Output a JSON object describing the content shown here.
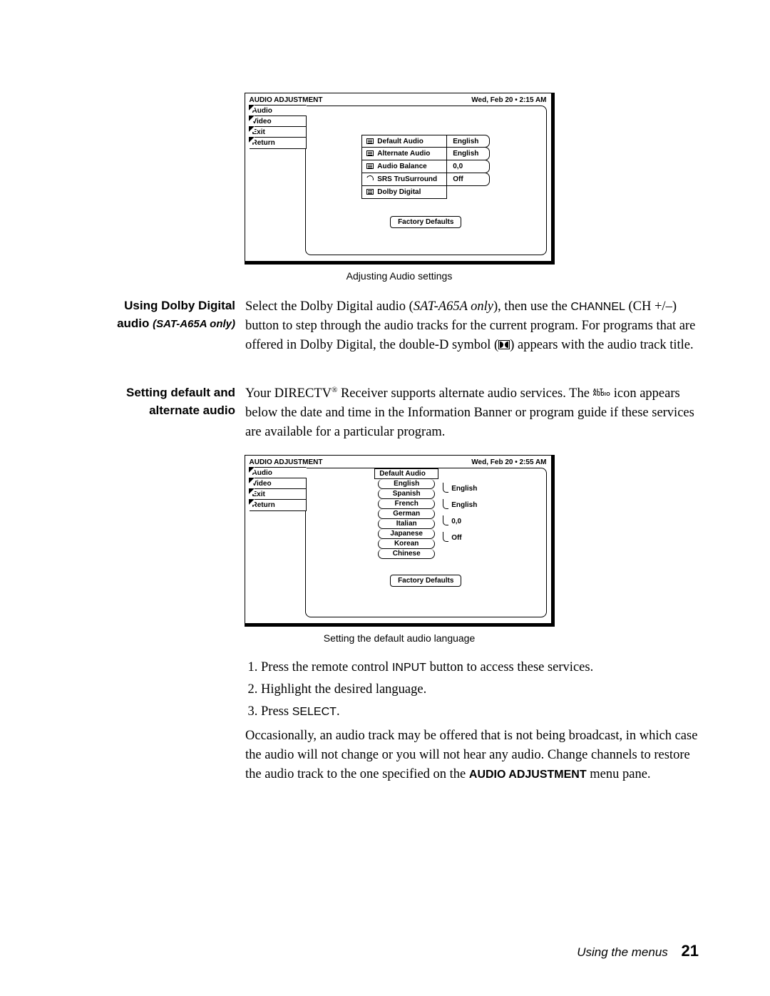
{
  "figure1": {
    "title": "AUDIO ADJUSTMENT",
    "timestamp": "Wed, Feb 20  •  2:15 AM",
    "tabs": [
      "Audio",
      "Video",
      "Exit",
      "Return"
    ],
    "options": [
      {
        "label": "Default Audio",
        "value": "English",
        "icon": "list"
      },
      {
        "label": "Alternate Audio",
        "value": "English",
        "icon": "list"
      },
      {
        "label": "Audio Balance",
        "value": "0,0",
        "icon": "list"
      },
      {
        "label": "SRS TruSurround",
        "value": "Off",
        "icon": "cycle"
      },
      {
        "label": "Dolby Digital",
        "value": "",
        "icon": "list"
      }
    ],
    "factory": "Factory Defaults",
    "caption": "Adjusting Audio settings"
  },
  "section1": {
    "heading_a": "Using Dolby Digital",
    "heading_b": "audio",
    "heading_note": "(SAT-A65A only)",
    "para_a": "Select the Dolby Digital audio (",
    "para_a_em": "SAT-A65A only",
    "para_a2": "), then use the ",
    "para_a_sc": "CHANNEL",
    "para_b": "(CH +/–) button to step through the audio tracks for the current program. For programs that are offered in Dolby Digital, the double-D symbol (",
    "para_b2": ") appears with the audio track title."
  },
  "section2": {
    "heading_a": "Setting default and",
    "heading_b": "alternate audio",
    "para_a": "Your DIRECTV",
    "reg": "®",
    "para_a2": " Receiver supports alternate audio services. The ",
    "alt_top": "ALT.",
    "alt_bot": "AUDIO",
    "para_a3": " icon appears below the date and time in the Information Banner or program guide if these services are available for a particular program."
  },
  "figure2": {
    "title": "AUDIO ADJUSTMENT",
    "timestamp": "Wed, Feb 20  •  2:55 AM",
    "tabs": [
      "Audio",
      "Video",
      "Exit",
      "Return"
    ],
    "dropdown_head": "Default Audio",
    "languages": [
      "English",
      "Spanish",
      "French",
      "German",
      "Italian",
      "Japanese",
      "Korean",
      "Chinese"
    ],
    "summary": [
      "English",
      "English",
      "0,0",
      "Off"
    ],
    "factory": "Factory Defaults",
    "caption": "Setting the default audio language"
  },
  "steps": {
    "s1a": "Press the remote control ",
    "s1sc": "INPUT",
    "s1b": " button to access these services.",
    "s2": "Highlight the desired language.",
    "s3a": "Press ",
    "s3sc": "SELECT",
    "s3b": "."
  },
  "closing": {
    "p1": "Occasionally, an audio track may be offered that is not being broadcast, in which case the audio will not change or you will not hear any audio. Change channels to restore the audio track to the one specified on the ",
    "bold": "AUDIO ADJUSTMENT",
    "p2": " menu pane."
  },
  "footer": {
    "text": "Using the menus",
    "page": "21"
  }
}
